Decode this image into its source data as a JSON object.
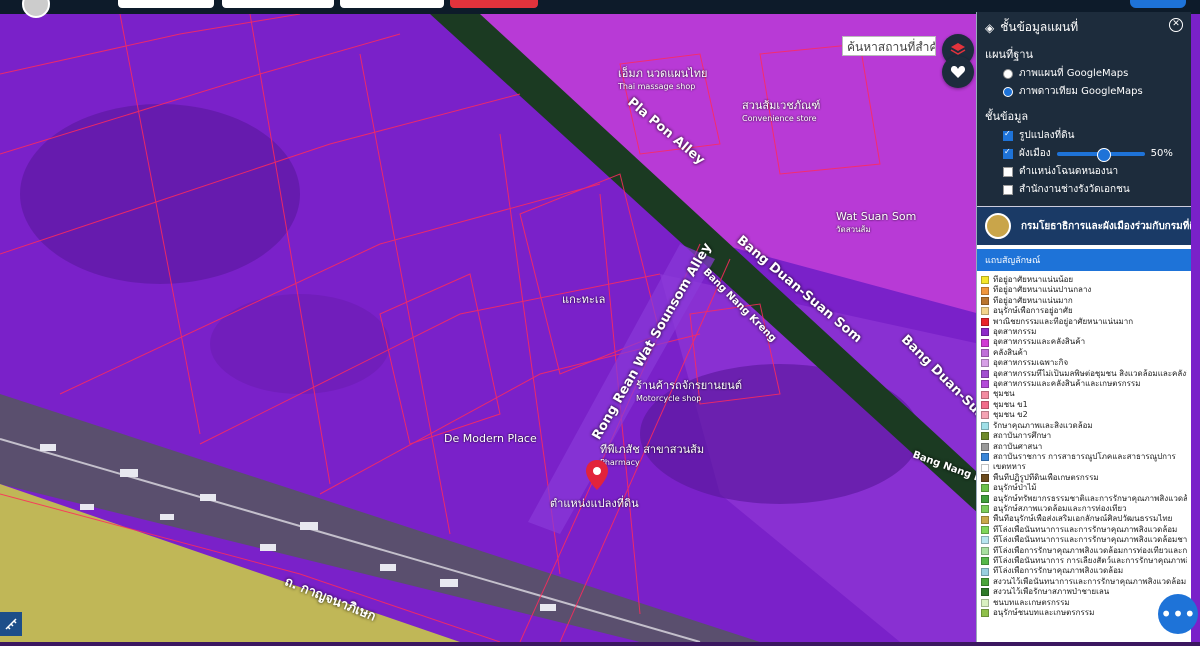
{
  "map": {
    "search_placeholder": "ค้นหาสถานที่สำคัญ",
    "marker_label": "ตำแหน่งแปลงที่ดิน",
    "poi": [
      {
        "name": "เอ็มภ นวดแผนไทย",
        "sub": "Thai massage shop"
      },
      {
        "name": "สวนส้มเวชภัณฑ์",
        "sub": "Convenience store"
      },
      {
        "name": "แกะทะเล",
        "sub": ""
      },
      {
        "name": "ร้านค้ารถจักรยานยนต์",
        "sub": "Motorcycle shop"
      },
      {
        "name": "De Modern Place",
        "sub": ""
      },
      {
        "name": "ทีพีเภสัช สาขาสวนส้ม",
        "sub": "Pharmacy"
      },
      {
        "name": "Wat Suan Som",
        "sub": "วัดสวนส้ม"
      }
    ],
    "roads": [
      "Pla Pon Alley",
      "Bang Duan-Suan Som",
      "Rong Rean Wat Sounsom Alley",
      "Bang Nang Kreng",
      "Bang Duan-Suan Som",
      "Bang Nang Kreng",
      "ถ. กาญจนาภิเษก"
    ],
    "colors": {
      "purple": "#8a2be2",
      "magenta": "#c33bd8",
      "yellow": "#c8c84a",
      "parcel": "#ff2a5c"
    }
  },
  "panel": {
    "title": "ชั้นข้อมูลแผนที่",
    "basemap_heading": "แผนที่ฐาน",
    "basemaps": [
      {
        "label": "ภาพแผนที่ GoogleMaps",
        "on": false
      },
      {
        "label": "ภาพดาวเทียม GoogleMaps",
        "on": true
      }
    ],
    "layers_heading": "ชั้นข้อมูล",
    "layers": [
      {
        "label": "รูปแปลงที่ดิน",
        "on": true
      },
      {
        "label": "ผังเมือง",
        "on": true,
        "opacity": "50%"
      },
      {
        "label": "ตำแหน่งโฉนดหนองนา",
        "on": false
      },
      {
        "label": "สำนักงานช่างรังวัดเอกชน",
        "on": false
      }
    ],
    "org_name": "กรมโยธาธิการและผังเมืองร่วมกับกรมที่ดิน",
    "legend_tab": "แถบสัญลักษณ์",
    "legend": [
      {
        "label": "ที่อยู่อาศัยหนาแน่นน้อย",
        "color": "#f5e62a"
      },
      {
        "label": "ที่อยู่อาศัยหนาแน่นปานกลาง",
        "color": "#f0963c"
      },
      {
        "label": "ที่อยู่อาศัยหนาแน่นมาก",
        "color": "#b9762e"
      },
      {
        "label": "อนุรักษ์เพื่อการอยู่อาศัย",
        "color": "#f3d58a"
      },
      {
        "label": "พาณิชยกรรมและที่อยู่อาศัยหนาแน่นมาก",
        "color": "#e8262a"
      },
      {
        "label": "อุตสาหกรรม",
        "color": "#8e2cc8"
      },
      {
        "label": "อุตสาหกรรมและคลังสินค้า",
        "color": "#d13cd3"
      },
      {
        "label": "คลังสินค้า",
        "color": "#c070d8"
      },
      {
        "label": "อุตสาหกรรมเฉพาะกิจ",
        "color": "#d7a0e6"
      },
      {
        "label": "อุตสาหกรรมที่ไม่เป็นมลพิษต่อชุมชน สิ่งแวดล้อมและคลังสินค้า",
        "color": "#a24fd0"
      },
      {
        "label": "อุตสาหกรรมและคลังสินค้าและเกษตรกรรม",
        "color": "#b44bd9"
      },
      {
        "label": "ชุมชน",
        "color": "#f38ba0"
      },
      {
        "label": "ชุมชน ข1",
        "color": "#f26b8a"
      },
      {
        "label": "ชุมชน ข2",
        "color": "#f5a4b4"
      },
      {
        "label": "รักษาคุณภาพและสิ่งแวดล้อม",
        "color": "#9fe0e8"
      },
      {
        "label": "สถาบันการศึกษา",
        "color": "#6f8a2a"
      },
      {
        "label": "สถาบันศาสนา",
        "color": "#9a9a9a"
      },
      {
        "label": "สถาบันราชการ การสาธารณูปโภคและสาธารณูปการ",
        "color": "#3a86d8"
      },
      {
        "label": "เขตทหาร",
        "color": "#ffffff"
      },
      {
        "label": "พื้นที่ปฏิรูปที่ดินเพื่อเกษตรกรรม",
        "color": "#6b4a1c"
      },
      {
        "label": "อนุรักษ์ป่าไม้",
        "color": "#6cc04a"
      },
      {
        "label": "อนุรักษ์ทรัพยากรธรรมชาติและการรักษาคุณภาพสิ่งแวดล้อม",
        "color": "#3f9d3a"
      },
      {
        "label": "อนุรักษ์สภาพแวดล้อมและการท่องเที่ยว",
        "color": "#7acb5a"
      },
      {
        "label": "พื้นที่อนุรักษ์เพื่อส่งเสริมเอกลักษณ์ศิลปวัฒนธรรมไทย",
        "color": "#c8a84a"
      },
      {
        "label": "ที่โล่งเพื่อนันทนาการและการรักษาคุณภาพสิ่งแวดล้อม",
        "color": "#7fd65a"
      },
      {
        "label": "ที่โล่งเพื่อนันทนาการและการรักษาคุณภาพสิ่งแวดล้อมชายฝั่ง",
        "color": "#b8e6f0"
      },
      {
        "label": "ที่โล่งเพื่อการรักษาคุณภาพสิ่งแวดล้อมการท่องเที่ยวและการป",
        "color": "#a8e0a0"
      },
      {
        "label": "ที่โล่งเพื่อนันทนาการ การเลี้ยงสัตว์และการรักษาคุณภาพสิ่งแ",
        "color": "#56b84a"
      },
      {
        "label": "ที่โล่งเพื่อการรักษาคุณภาพสิ่งแวดล้อม",
        "color": "#9ad0e0"
      },
      {
        "label": "สงวนไว้เพื่อนันทนาการและการรักษาคุณภาพสิ่งแวดล้อม",
        "color": "#4aa53a"
      },
      {
        "label": "สงวนไว้เพื่อรักษาสภาพป่าชายเลน",
        "color": "#2f7a2a"
      },
      {
        "label": "ชนบทและเกษตรกรรม",
        "color": "#d9f0c0"
      },
      {
        "label": "อนุรักษ์ชนบทและเกษตรกรรม",
        "color": "#8fc04a"
      }
    ]
  }
}
